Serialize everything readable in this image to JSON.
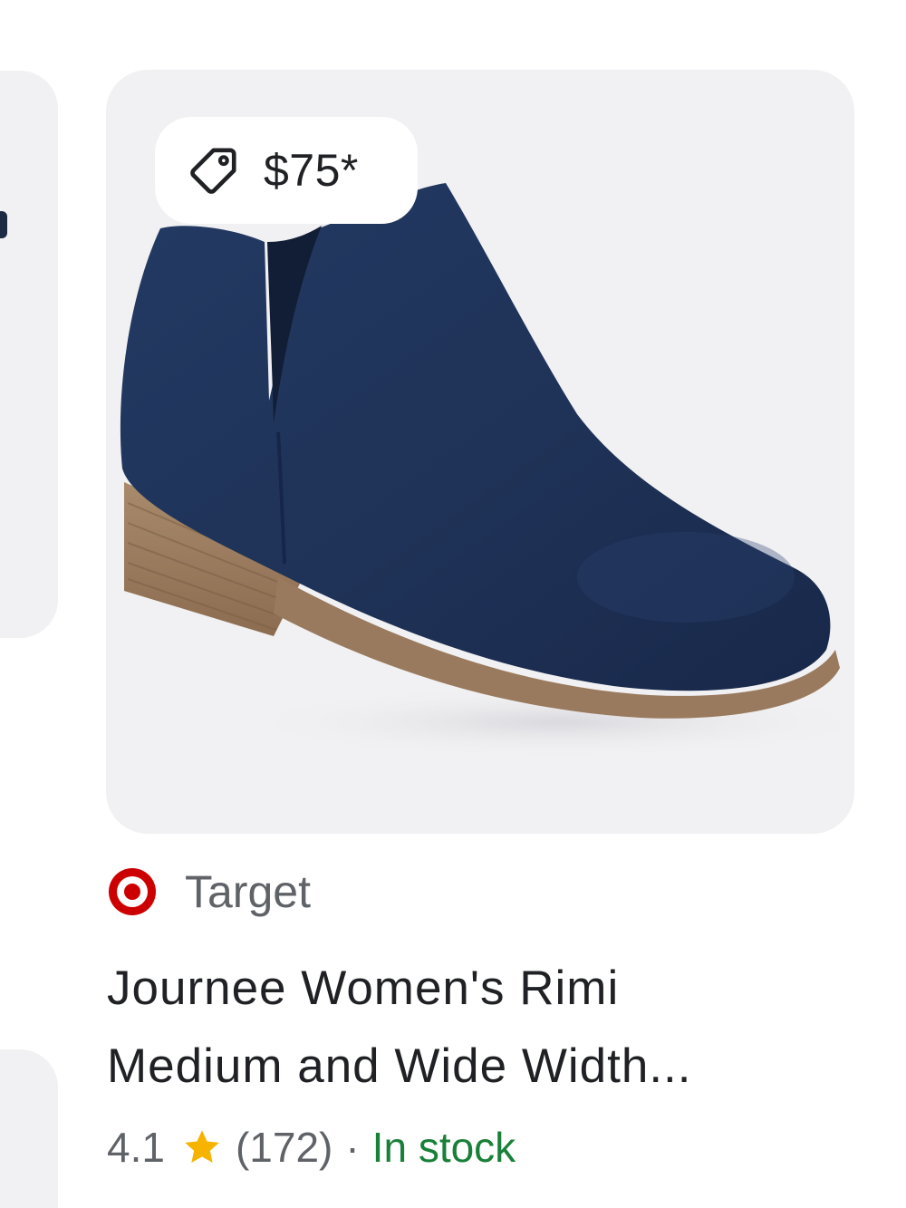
{
  "product": {
    "price": "$75*",
    "merchant": "Target",
    "title_line1": "Journee Women's Rimi",
    "title_line2": "Medium and Wide Width...",
    "rating": "4.1",
    "reviews": "(172)",
    "separator": "·",
    "availability": "In stock"
  },
  "icons": {
    "price_tag": "tag-icon",
    "merchant_logo": "target-logo-icon",
    "rating_star": "star-icon"
  },
  "colors": {
    "card_background": "#f1f1f3",
    "merchant_brand": "#cc0000",
    "availability_green": "#188038",
    "star_gold": "#f6b400",
    "boot_navy": "#1f3257",
    "sole_tan": "#9a7a5e"
  }
}
